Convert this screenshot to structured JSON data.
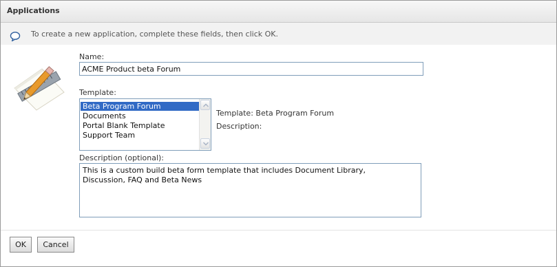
{
  "header": {
    "title": "Applications"
  },
  "info": {
    "icon": "speech-bubble-icon",
    "text": "To create a new application, complete these fields, then click OK."
  },
  "app_image": {
    "icon": "pencil-ruler-icon"
  },
  "form": {
    "name_label": "Name:",
    "name_value": "ACME Product beta Forum",
    "template_label": "Template:",
    "template_options": [
      "Beta Program Forum",
      "Documents",
      "Portal Blank Template",
      "Support Team"
    ],
    "template_selected": "Beta Program Forum",
    "template_detail_label": "Template: Beta Program Forum",
    "description_detail_label": "Description:",
    "description_label": "Description (optional):",
    "description_value": "This is a custom build beta form template that includes Document Library,\nDiscussion, FAQ and Beta News"
  },
  "buttons": {
    "ok_label": "OK",
    "cancel_label": "Cancel"
  },
  "colors": {
    "selection": "#316ac5",
    "input_border": "#7f9db9"
  }
}
